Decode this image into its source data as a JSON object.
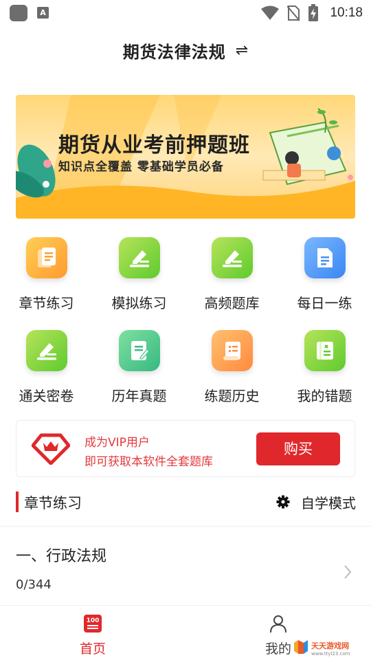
{
  "status_bar": {
    "time": "10:18",
    "notification_glyph": "A"
  },
  "header": {
    "title": "期货法律法规",
    "switch_icon": "swap-icon"
  },
  "banner": {
    "title": "期货从业考前押题班",
    "subtitle": "知识点全覆盖  零基础学员必备"
  },
  "features": [
    {
      "label": "章节练习",
      "icon": "chapter-practice-icon"
    },
    {
      "label": "模拟练习",
      "icon": "mock-practice-icon"
    },
    {
      "label": "高频题库",
      "icon": "high-frequency-bank-icon"
    },
    {
      "label": "每日一练",
      "icon": "daily-practice-icon"
    },
    {
      "label": "通关密卷",
      "icon": "secret-paper-icon"
    },
    {
      "label": "历年真题",
      "icon": "past-exams-icon"
    },
    {
      "label": "练题历史",
      "icon": "practice-history-icon"
    },
    {
      "label": "我的错题",
      "icon": "wrong-questions-icon"
    }
  ],
  "vip": {
    "line1": "成为VIP用户",
    "line2": "即可获取本软件全套题库",
    "button": "购买",
    "accent": "#e0282c"
  },
  "section": {
    "title": "章节练习",
    "mode_label": "自学模式"
  },
  "chapters": [
    {
      "name": "一、行政法规",
      "progress": "0/344"
    }
  ],
  "bottom_nav": {
    "home_label": "首页",
    "home_badge": "100",
    "mine_label": "我的"
  },
  "watermark": {
    "text": "天天游戏网",
    "url": "www.ttyl23.com"
  }
}
